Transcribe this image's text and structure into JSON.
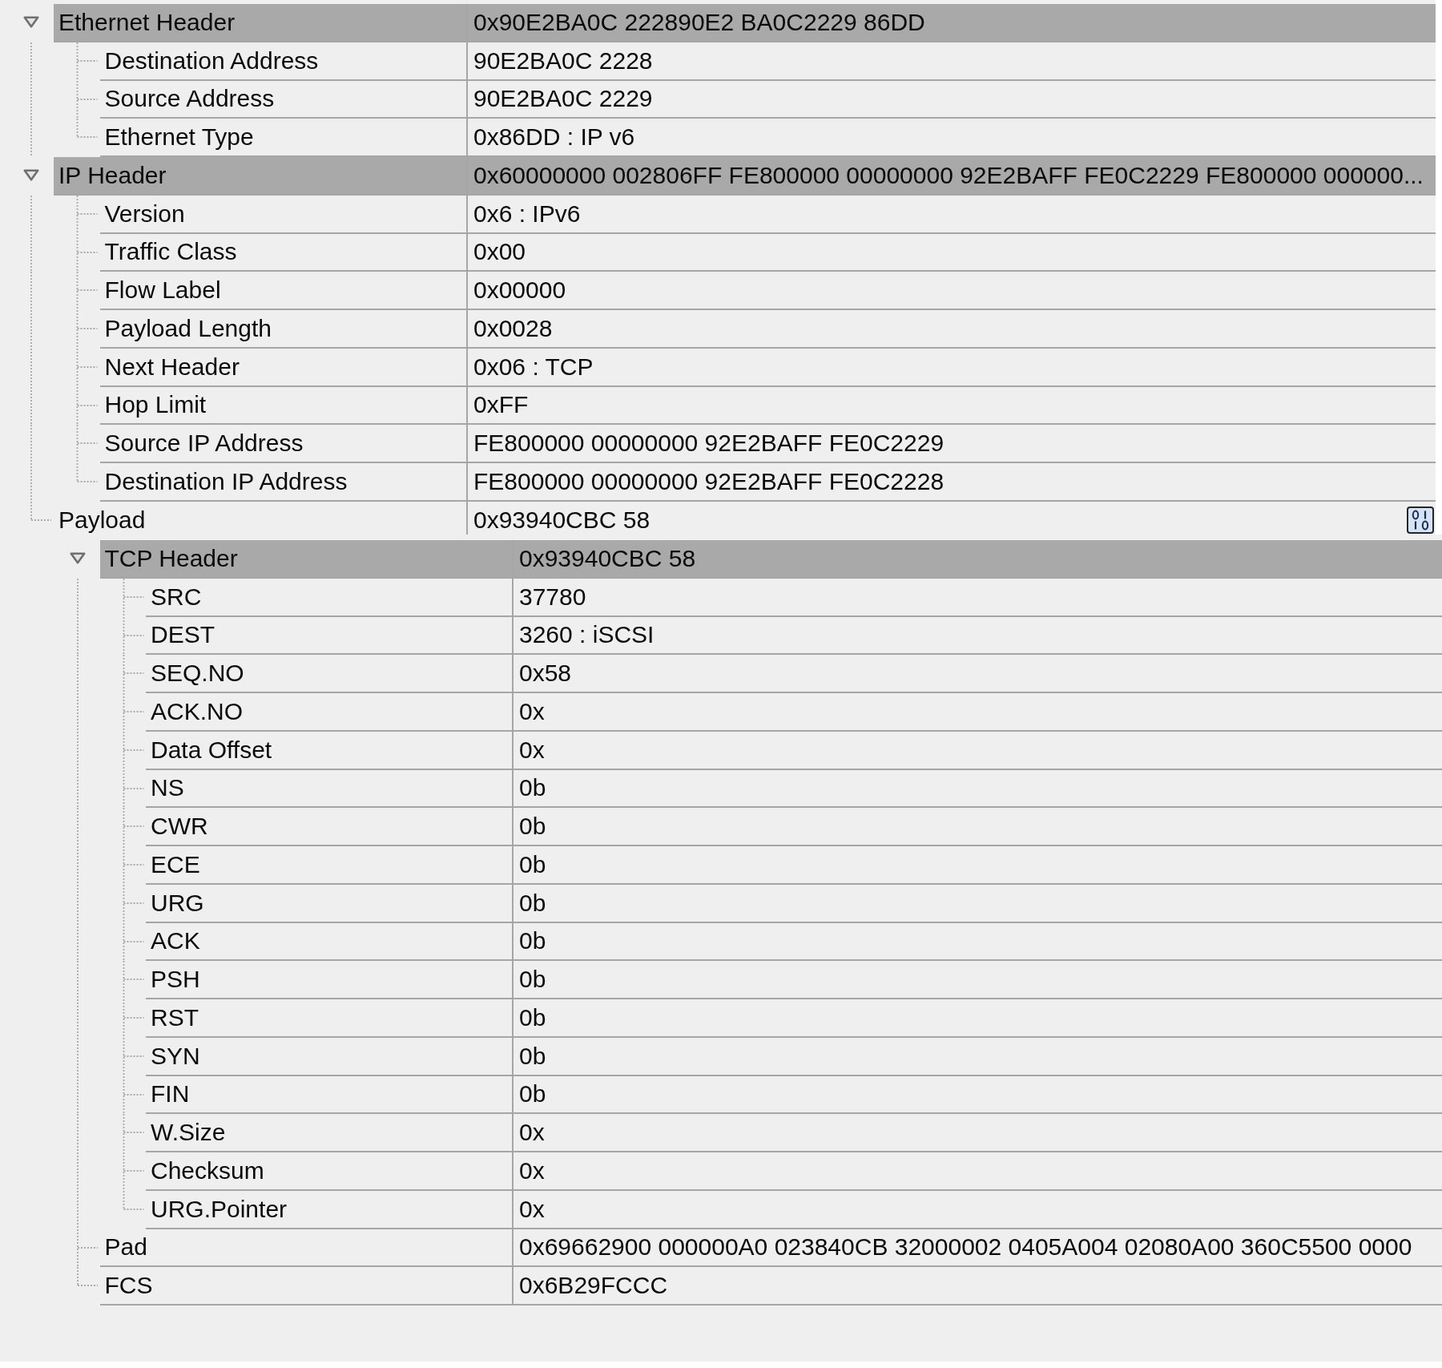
{
  "panes": [
    {
      "nodes": [
        {
          "kind": "group",
          "label": "Ethernet Header",
          "value": "0x90E2BA0C 222890E2 BA0C2229 86DD",
          "expanded": true,
          "children": [
            {
              "kind": "field",
              "label": "Destination Address",
              "value": "90E2BA0C 2228"
            },
            {
              "kind": "field",
              "label": "Source Address",
              "value": "90E2BA0C 2229"
            },
            {
              "kind": "field",
              "label": "Ethernet Type",
              "value": "0x86DD : IP v6"
            }
          ]
        },
        {
          "kind": "group",
          "label": "IP Header",
          "value": "0x60000000 002806FF FE800000 00000000 92E2BAFF FE0C2229 FE800000 000000...",
          "expanded": true,
          "children": [
            {
              "kind": "field",
              "label": "Version",
              "value": "0x6 : IPv6"
            },
            {
              "kind": "field",
              "label": "Traffic Class",
              "value": "0x00"
            },
            {
              "kind": "field",
              "label": "Flow Label",
              "value": "0x00000"
            },
            {
              "kind": "field",
              "label": "Payload Length",
              "value": "0x0028"
            },
            {
              "kind": "field",
              "label": "Next Header",
              "value": "0x06 : TCP"
            },
            {
              "kind": "field",
              "label": "Hop Limit",
              "value": "0xFF"
            },
            {
              "kind": "field",
              "label": "Source IP Address",
              "value": "FE800000 00000000 92E2BAFF FE0C2229"
            },
            {
              "kind": "field",
              "label": "Destination IP Address",
              "value": "FE800000 00000000 92E2BAFF FE0C2228"
            }
          ]
        },
        {
          "kind": "data",
          "label": "Payload",
          "value": "0x93940CBC 58"
        }
      ]
    },
    {
      "nodes": [
        {
          "kind": "group",
          "label": "TCP Header",
          "value": "0x93940CBC 58",
          "expanded": true,
          "children": [
            {
              "kind": "field",
              "label": "SRC",
              "value": "37780"
            },
            {
              "kind": "field",
              "label": "DEST",
              "value": "3260 : iSCSI"
            },
            {
              "kind": "field",
              "label": "SEQ.NO",
              "value": "0x58"
            },
            {
              "kind": "field",
              "label": "ACK.NO",
              "value": "0x"
            },
            {
              "kind": "field",
              "label": "Data Offset",
              "value": "0x"
            },
            {
              "kind": "field",
              "label": "NS",
              "value": "0b"
            },
            {
              "kind": "field",
              "label": "CWR",
              "value": "0b"
            },
            {
              "kind": "field",
              "label": "ECE",
              "value": "0b"
            },
            {
              "kind": "field",
              "label": "URG",
              "value": "0b"
            },
            {
              "kind": "field",
              "label": "ACK",
              "value": "0b"
            },
            {
              "kind": "field",
              "label": "PSH",
              "value": "0b"
            },
            {
              "kind": "field",
              "label": "RST",
              "value": "0b"
            },
            {
              "kind": "field",
              "label": "SYN",
              "value": "0b"
            },
            {
              "kind": "field",
              "label": "FIN",
              "value": "0b"
            },
            {
              "kind": "field",
              "label": "W.Size",
              "value": "0x"
            },
            {
              "kind": "field",
              "label": "Checksum",
              "value": "0x"
            },
            {
              "kind": "field",
              "label": "URG.Pointer",
              "value": "0x"
            }
          ]
        },
        {
          "kind": "field",
          "label": "Pad",
          "value": "0x69662900 000000A0 023840CB 32000002 0405A004 02080A00 360C5500 0000"
        },
        {
          "kind": "field",
          "label": "FCS",
          "value": "0x6B29FCCC"
        }
      ]
    }
  ]
}
